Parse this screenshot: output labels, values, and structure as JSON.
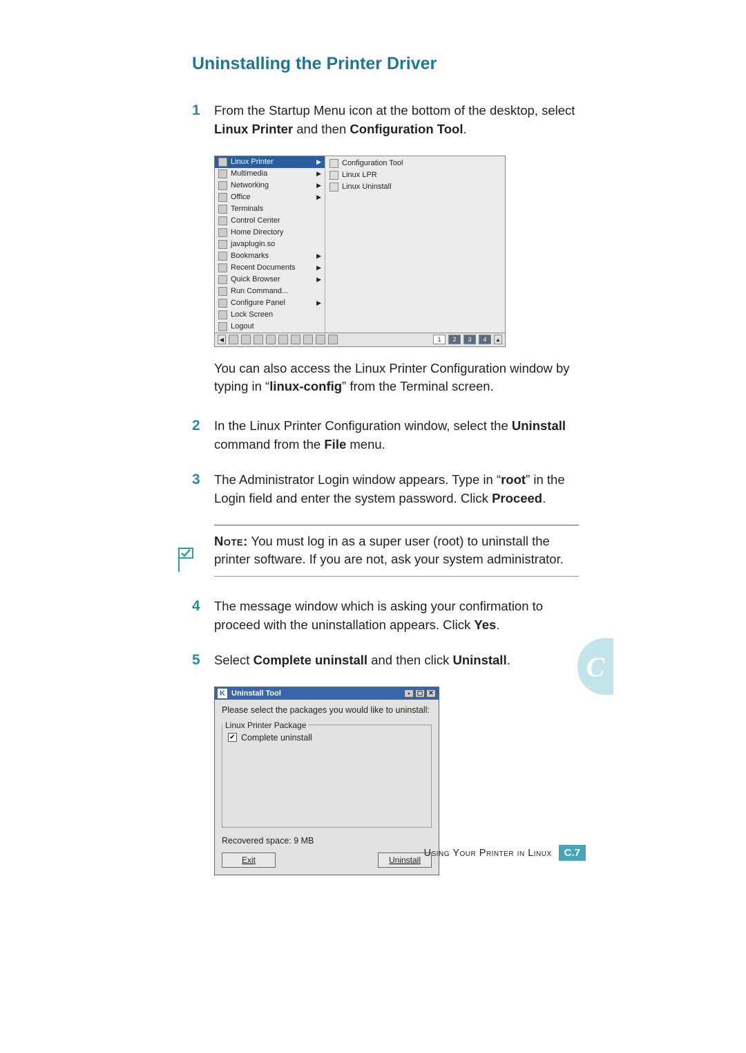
{
  "heading": "Uninstalling the Printer Driver",
  "steps": {
    "1": {
      "num": "1",
      "pre": "From the Startup Menu icon at the bottom of the desktop, select ",
      "b1": "Linux Printer",
      "mid": " and then ",
      "b2": "Configuration Tool",
      "post": "."
    },
    "after1_line1": "You can also access the Linux Printer Configuration window by typing in “",
    "after1_bold": "linux-config",
    "after1_line2": "” from the Terminal screen.",
    "2": {
      "num": "2",
      "pre": "In the Linux Printer Configuration window, select the ",
      "b1": "Uninstall",
      "mid": " command from the ",
      "b2": "File",
      "post": " menu."
    },
    "3": {
      "num": "3",
      "pre": "The Administrator Login window appears. Type in “",
      "b1": "root",
      "mid": "” in the Login field and enter the system password. Click ",
      "b2": "Proceed",
      "post": "."
    },
    "4": {
      "num": "4",
      "pre": "The message window which is asking your confirmation to proceed with the uninstallation appears. Click ",
      "b1": "Yes",
      "post": "."
    },
    "5": {
      "num": "5",
      "pre": "Select ",
      "b1": "Complete uninstall",
      "mid": " and then click ",
      "b2": "Uninstall",
      "post": "."
    }
  },
  "note": {
    "label": "Note:",
    "text": " You must log in as a super user (root) to uninstall the printer software. If you are not, ask your system administrator."
  },
  "menu1": {
    "left": [
      "Linux Printer",
      "Multimedia",
      "Networking",
      "Office",
      "Terminals",
      "Control Center",
      "Home Directory",
      "javaplugin.so",
      "Bookmarks",
      "Recent Documents",
      "Quick Browser",
      "Run Command...",
      "Configure Panel",
      "Lock Screen",
      "Logout"
    ],
    "left_has_arrow": [
      true,
      true,
      true,
      true,
      false,
      false,
      false,
      false,
      true,
      true,
      true,
      false,
      true,
      false,
      false
    ],
    "right": [
      "Configuration Tool",
      "Linux LPR",
      "Linux Uninstall"
    ],
    "taskbar_pages": [
      "1",
      "2",
      "3",
      "4"
    ]
  },
  "uninstall_tool": {
    "title": "Uninstall Tool",
    "k": "K",
    "msg": "Please select the packages you would like to uninstall:",
    "group": "Linux Printer Package",
    "checkbox": "Complete uninstall",
    "recovered": "Recovered space:  9 MB",
    "exit": "Exit",
    "uninstall": "Uninstall"
  },
  "footer": {
    "text": "Using Your Printer in Linux",
    "badge_prefix": "C.",
    "badge_num": "7"
  },
  "sidetab": "C"
}
